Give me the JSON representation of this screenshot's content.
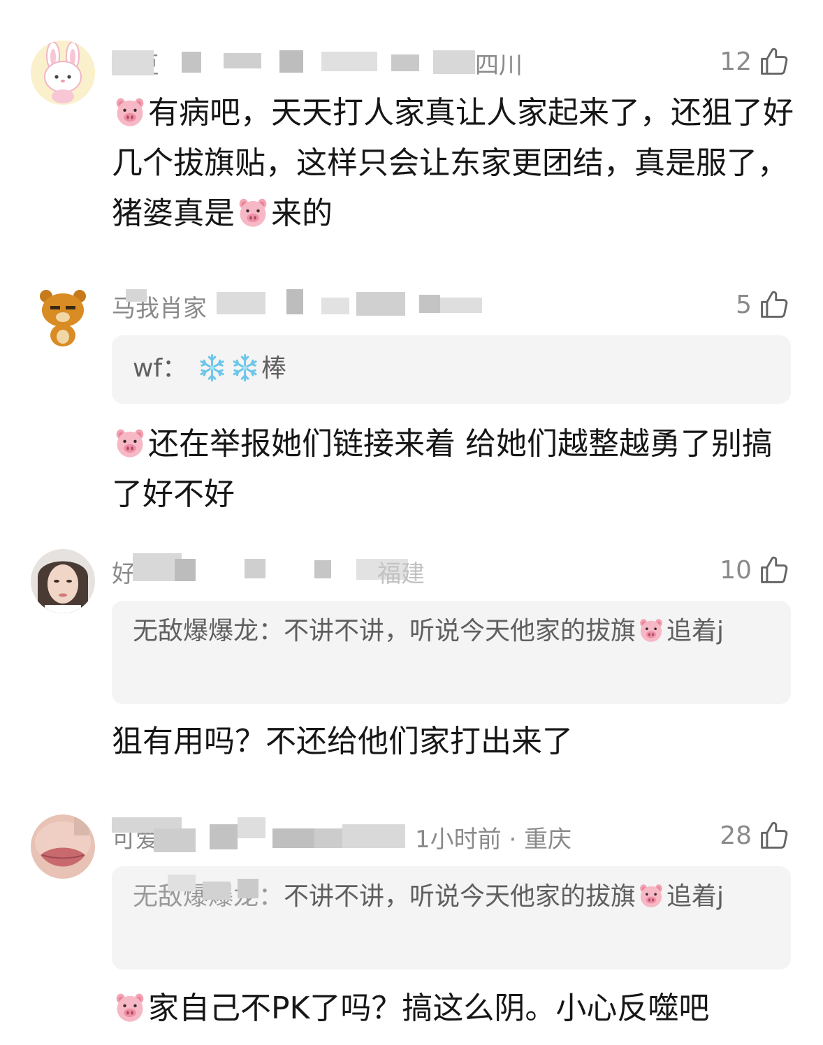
{
  "comments": [
    {
      "username": "豆豆",
      "location": "四川",
      "likes": "12",
      "avatar_icon": "bunny-avatar-icon",
      "text_1": "有病吧，天天打人家真让人家起来了，还狙了好几个拔旗贴，这样只会让东家更团结，真是服了，猪婆真是",
      "text_2": "来的"
    },
    {
      "username": "马我肖家",
      "likes": "5",
      "avatar_icon": "bear-avatar-icon",
      "quote_name": "wf：",
      "quote_text": "棒",
      "text": "还在举报她们链接来着 给她们越整越勇了别搞了好不好"
    },
    {
      "username": "好",
      "location": "福建",
      "likes": "10",
      "avatar_icon": "photo-avatar-icon",
      "quote_name": "无敌爆爆龙：",
      "quote_text_1": "不讲不讲，听说今天他家的拔旗",
      "quote_text_2": "追着j",
      "text": "狙有用吗？不还给他们家打出来了"
    },
    {
      "username": "可爱",
      "time_location": "1小时前 · 重庆",
      "likes": "28",
      "avatar_icon": "lips-avatar-icon",
      "quote_name": "无敌爆爆龙：",
      "quote_text_1": "不讲不讲，听说今天他家的拔旗",
      "quote_text_2": "追着j",
      "text": "家自己不PK了吗？搞这么阴。小心反噬吧"
    }
  ],
  "colors": {
    "meta_gray": "#8a8a8a",
    "quote_bg": "#f4f4f4",
    "body_text": "#161616"
  }
}
